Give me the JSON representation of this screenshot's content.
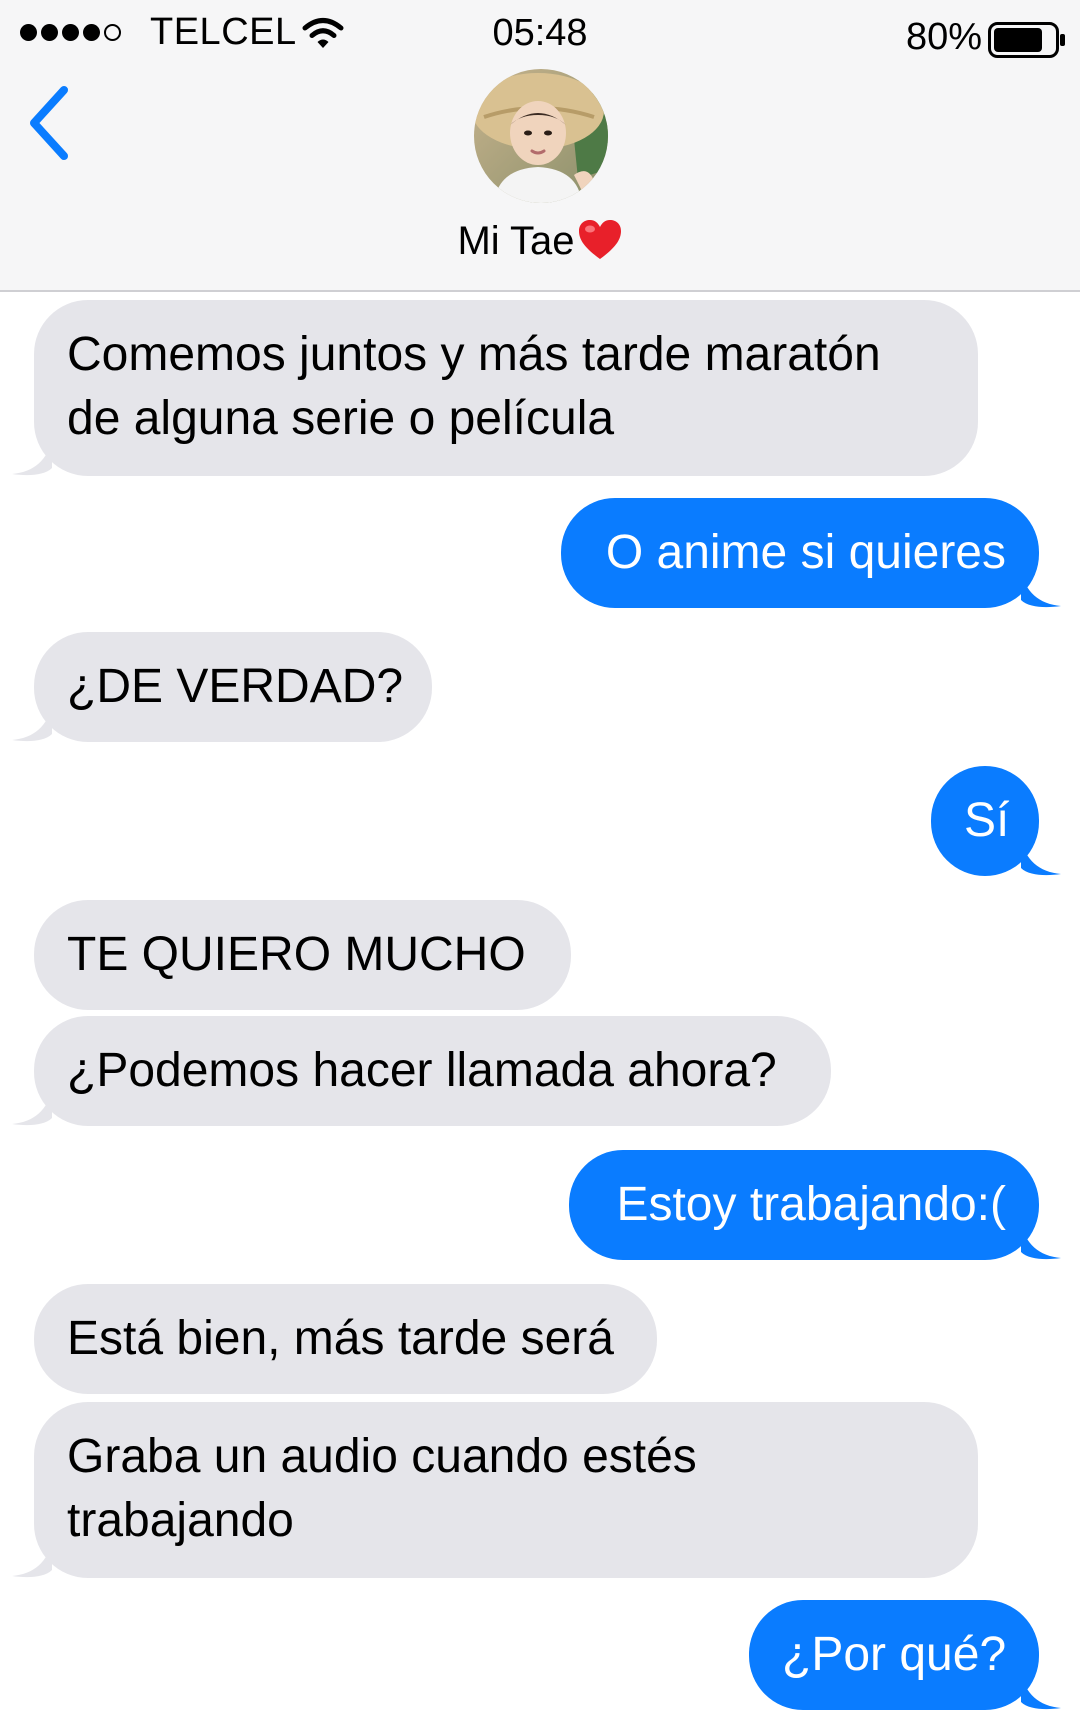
{
  "status_bar": {
    "carrier": "TELCEL",
    "time": "05:48",
    "battery_percent": "80%",
    "signal_bars_filled": 4,
    "signal_bars_total": 5
  },
  "contact": {
    "name": "Mi Tae",
    "name_suffix_icon": "red-heart-icon"
  },
  "colors": {
    "incoming_bubble": "#e5e5ea",
    "outgoing_bubble": "#0a7cff",
    "accent": "#0a7cff",
    "header_bg": "#f6f6f7"
  },
  "messages": [
    {
      "direction": "in",
      "lines": [
        "Comemos juntos y más tarde maratón",
        "de alguna serie o película"
      ]
    },
    {
      "direction": "out",
      "lines": [
        "O anime si quieres"
      ]
    },
    {
      "direction": "in",
      "lines": [
        "¿DE VERDAD?"
      ]
    },
    {
      "direction": "out",
      "lines": [
        "Sí"
      ]
    },
    {
      "direction": "in",
      "lines": [
        "TE QUIERO MUCHO"
      ]
    },
    {
      "direction": "in",
      "lines": [
        "¿Podemos hacer llamada ahora?"
      ]
    },
    {
      "direction": "out",
      "lines": [
        "Estoy trabajando:("
      ]
    },
    {
      "direction": "in",
      "lines": [
        "Está bien, más tarde será"
      ]
    },
    {
      "direction": "in",
      "lines": [
        "Graba un audio cuando estés",
        "trabajando"
      ]
    },
    {
      "direction": "out",
      "lines": [
        "¿Por qué?"
      ]
    }
  ]
}
